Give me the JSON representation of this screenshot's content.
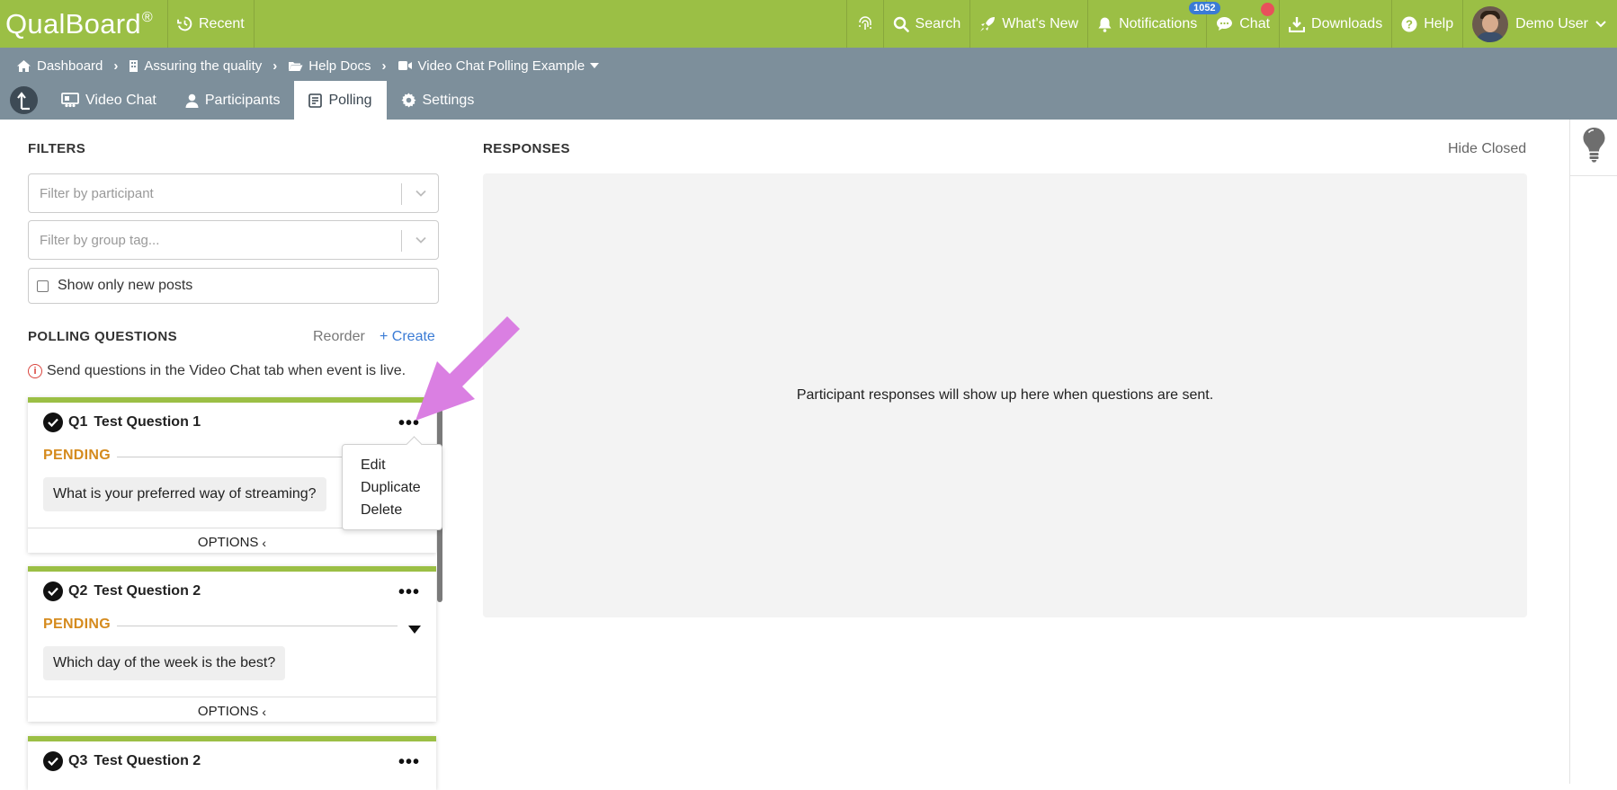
{
  "app": {
    "logo": "QualBoard",
    "logo_mark": "®"
  },
  "topnav": {
    "recent": "Recent",
    "search": "Search",
    "whats_new": "What's New",
    "notifications": "Notifications",
    "notifications_count": "1052",
    "chat": "Chat",
    "downloads": "Downloads",
    "help": "Help",
    "user": "Demo User"
  },
  "breadcrumb": {
    "items": [
      "Dashboard",
      "Assuring the quality",
      "Help Docs",
      "Video Chat Polling Example"
    ]
  },
  "tabs": {
    "items": [
      "Video Chat",
      "Participants",
      "Polling",
      "Settings"
    ],
    "active": "Polling"
  },
  "filters": {
    "title": "FILTERS",
    "participant_placeholder": "Filter by participant",
    "group_tag_placeholder": "Filter by group tag...",
    "show_new_label": "Show only new posts"
  },
  "polling": {
    "title": "POLLING QUESTIONS",
    "reorder": "Reorder",
    "create": "+ Create",
    "notice": "Send questions in the Video Chat tab when event is live.",
    "questions": [
      {
        "num": "Q1",
        "title": "Test Question 1",
        "status": "PENDING",
        "text": "What is your preferred way of streaming?",
        "options": "OPTIONS"
      },
      {
        "num": "Q2",
        "title": "Test Question 2",
        "status": "PENDING",
        "text": "Which day of the week is the best?",
        "options": "OPTIONS"
      },
      {
        "num": "Q3",
        "title": "Test Question 2"
      }
    ],
    "menu": [
      "Edit",
      "Duplicate",
      "Delete"
    ]
  },
  "responses": {
    "title": "RESPONSES",
    "hide_closed": "Hide Closed",
    "empty_message": "Participant responses will show up here when questions are sent."
  },
  "colors": {
    "navbar": "#9bbf45",
    "subbar": "#7d8f9b",
    "pending": "#d58b1e",
    "link": "#3a7bd5",
    "arrow": "#da7fe2"
  }
}
